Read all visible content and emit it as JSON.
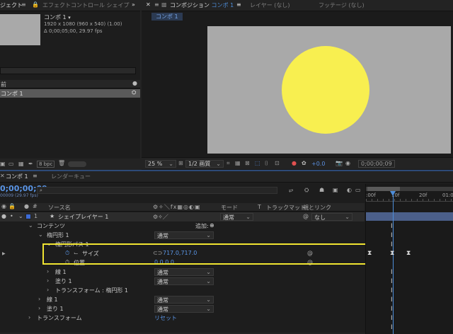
{
  "project_panel": {
    "tab_label": "ジェクト",
    "effects_tab_label": "エフェクトコントロール シェイプ",
    "comp_name": "コンポ 1",
    "comp_name_arrow": "▾",
    "comp_resolution": "1920 x 1080 (960 x 540) (1.00)",
    "comp_duration": "Δ 0;00;05;00, 29.97 fps",
    "column_header": "前",
    "item_label": "コンポ 1",
    "bpc_label": "8 bpc"
  },
  "viewer": {
    "tab_label": "コンポジション",
    "tab_comp": "コンポ 1",
    "layer_tab": "レイヤー (なし)",
    "footage_tab": "フッテージ (なし)",
    "breadcrumb": "コンポ 1",
    "zoom": "25 %",
    "resolution": "1/2 画質",
    "exposure": "+0.0",
    "timecode": "0;00;00;09",
    "canvas_color": "#a9a9a9",
    "ellipse_color": "#f8ef50"
  },
  "timeline": {
    "tab_label": "コンポ 1",
    "render_queue_tab": "レンダーキュー",
    "timecode": "0;00;00;09",
    "timecode_sub": "00009 (29.97 fps)",
    "search_placeholder": "",
    "headers": {
      "source_name": "ソース名",
      "mode": "モード",
      "t": "T",
      "track_matte": "トラックマット",
      "parent": "親とリンク"
    },
    "layer_number": "1",
    "layer_name": "シェイプレイヤー 1",
    "layer_mode": "通常",
    "layer_parent": "なし",
    "contents_label": "コンテンツ",
    "add_label": "追加:",
    "ellipse_group": "楕円形 1",
    "ellipse_group_mode": "通常",
    "ellipse_path": "楕円形パス 1",
    "size_label": "サイズ",
    "size_value": "717.0,717.0",
    "position_label": "位置",
    "position_value": "0.0,0.0",
    "stroke_label": "線 1",
    "stroke_mode": "通常",
    "fill_label": "塗り 1",
    "fill_mode": "通常",
    "transform_ellipse": "トランスフォーム : 楕円形 1",
    "stroke2_label": "線 1",
    "stroke2_mode": "通常",
    "fill2_label": "塗り 1",
    "fill2_mode": "通常",
    "transform_label": "トランスフォーム",
    "reset_label": "リセット",
    "ruler": {
      "t0": ":00f",
      "t1": "10f",
      "t2": "20f",
      "t3": "01:00"
    },
    "highlight_color": "#f0e431",
    "label_color": "#3d6bd6"
  }
}
